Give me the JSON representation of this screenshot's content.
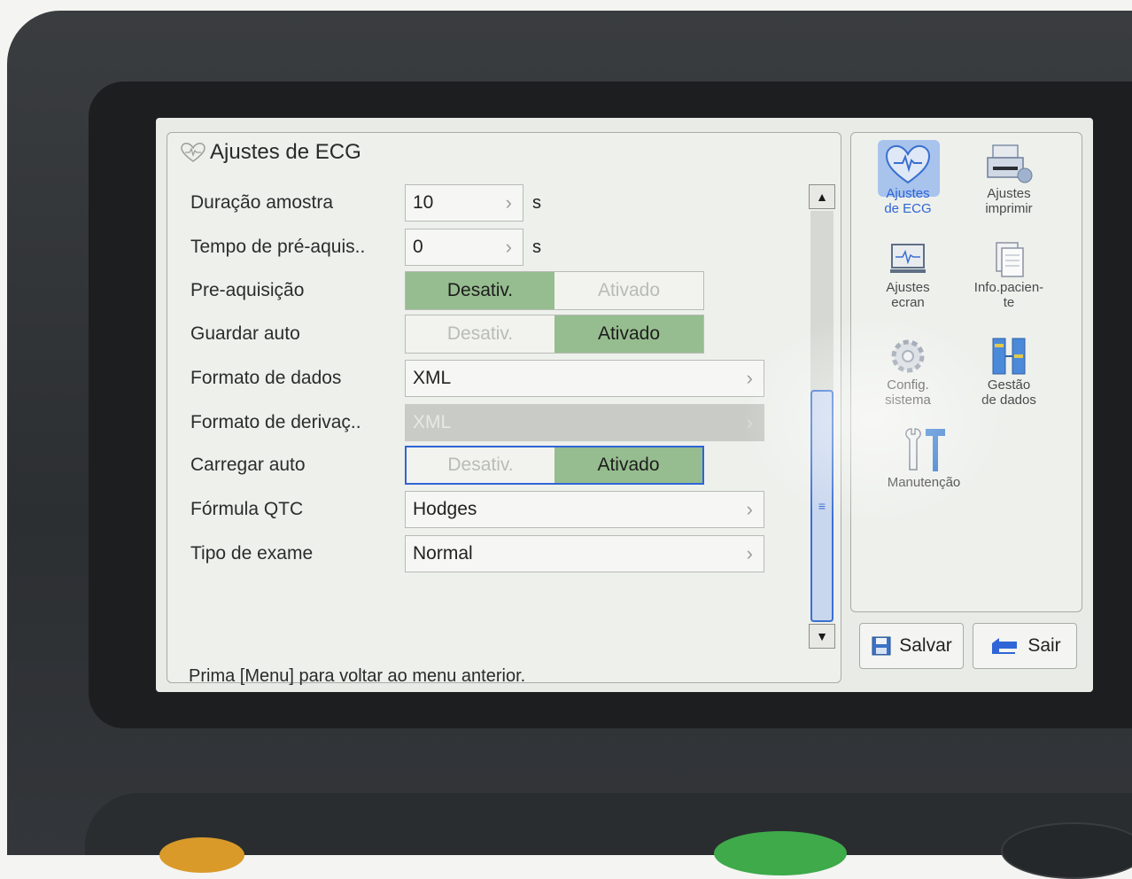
{
  "panel": {
    "title": "Ajustes de ECG",
    "status": "Prima [Menu] para voltar ao menu anterior."
  },
  "rows": [
    {
      "label": "Duração amostra",
      "value": "10",
      "unit": "s"
    },
    {
      "label": "Tempo de pré-aquis..",
      "value": "0",
      "unit": "s"
    },
    {
      "label": "Pre-aquisição",
      "opt1": "Desativ.",
      "opt2": "Ativado",
      "selected": "Desativ."
    },
    {
      "label": "Guardar auto",
      "opt1": "Desativ.",
      "opt2": "Ativado",
      "selected": "Ativado"
    },
    {
      "label": "Formato de dados",
      "value": "XML"
    },
    {
      "label": "Formato de derivaç..",
      "value": "XML",
      "disabled": true
    },
    {
      "label": "Carregar auto",
      "opt1": "Desativ.",
      "opt2": "Ativado",
      "selected": "Ativado",
      "focused": true
    },
    {
      "label": "Fórmula QTC",
      "value": "Hodges"
    },
    {
      "label": "Tipo de exame",
      "value": "Normal"
    }
  ],
  "sidebar": {
    "items": [
      {
        "label1": "Ajustes",
        "label2": "de ECG",
        "icon": "heart-icon",
        "active": true
      },
      {
        "label1": "Ajustes",
        "label2": "imprimir",
        "icon": "printer-icon"
      },
      {
        "label1": "Ajustes",
        "label2": "ecran",
        "icon": "monitor-icon"
      },
      {
        "label1": "Info.pacien-",
        "label2": "te",
        "icon": "document-icon"
      },
      {
        "label1": "Config.",
        "label2": "sistema",
        "icon": "gear-icon"
      },
      {
        "label1": "Gestão",
        "label2": "de dados",
        "icon": "data-transfer-icon"
      },
      {
        "label1": "Manutenção",
        "label2": "",
        "icon": "tools-icon"
      }
    ]
  },
  "buttons": {
    "save": "Salvar",
    "exit": "Sair"
  },
  "colors": {
    "accent": "#2f65d6",
    "toggle_on": "#96bd8f",
    "selection": "#a8c3ec"
  }
}
